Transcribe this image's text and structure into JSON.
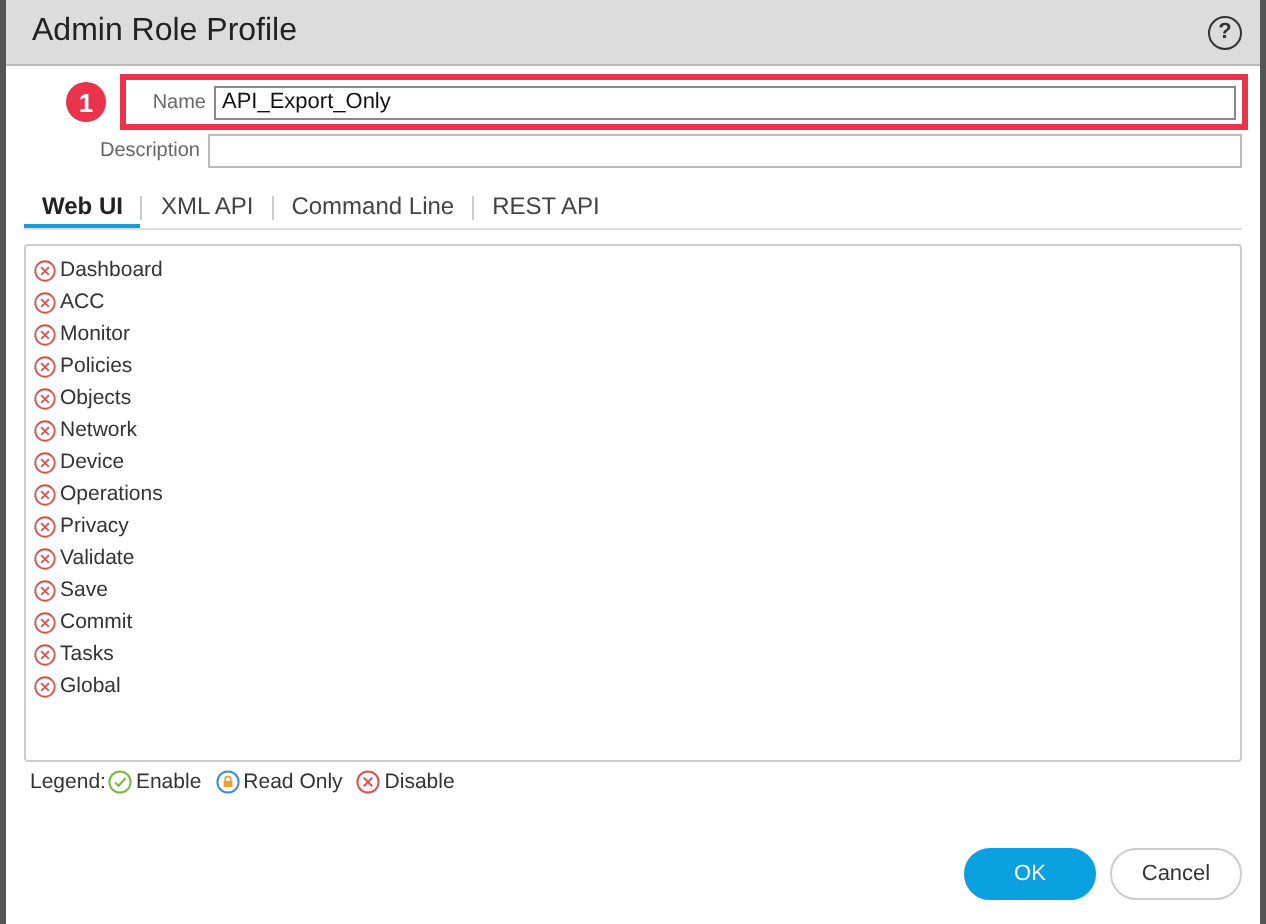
{
  "window": {
    "title": "Admin Role Profile",
    "help": "?"
  },
  "callout": {
    "number": "1"
  },
  "fields": [
    {
      "label": "Name",
      "value": "API_Export_Only",
      "highlighted": true
    },
    {
      "label": "Description",
      "highlighted": false
    }
  ],
  "tabs": [
    {
      "label": "Web UI",
      "selected": true
    },
    {
      "label": "XML API",
      "selected": false
    },
    {
      "label": "Command Line",
      "selected": false
    },
    {
      "label": "REST API",
      "selected": false
    }
  ],
  "permissions": [
    {
      "label": "Dashboard",
      "kind": "disable"
    },
    {
      "label": "ACC",
      "kind": "disable"
    },
    {
      "label": "Monitor",
      "kind": "disable"
    },
    {
      "label": "Policies",
      "kind": "disable"
    },
    {
      "label": "Objects",
      "kind": "disable"
    },
    {
      "label": "Network",
      "kind": "disable"
    },
    {
      "label": "Device",
      "kind": "disable"
    },
    {
      "label": "Operations",
      "kind": "disable"
    },
    {
      "label": "Privacy",
      "kind": "disable"
    },
    {
      "label": "Validate",
      "kind": "disable"
    },
    {
      "label": "Save",
      "kind": "disable"
    },
    {
      "label": "Commit",
      "kind": "disable"
    },
    {
      "label": "Tasks",
      "kind": "disable"
    },
    {
      "label": "Global",
      "kind": "disable"
    }
  ],
  "legend": {
    "title": "Legend:",
    "items": [
      {
        "label": "Enable",
        "kind": "enable"
      },
      {
        "label": "Read Only",
        "kind": "readonly"
      },
      {
        "label": "Disable",
        "kind": "disable"
      }
    ]
  },
  "buttons": [
    {
      "label": "OK",
      "kind": "primary"
    },
    {
      "label": "Cancel",
      "kind": "secondary"
    }
  ]
}
